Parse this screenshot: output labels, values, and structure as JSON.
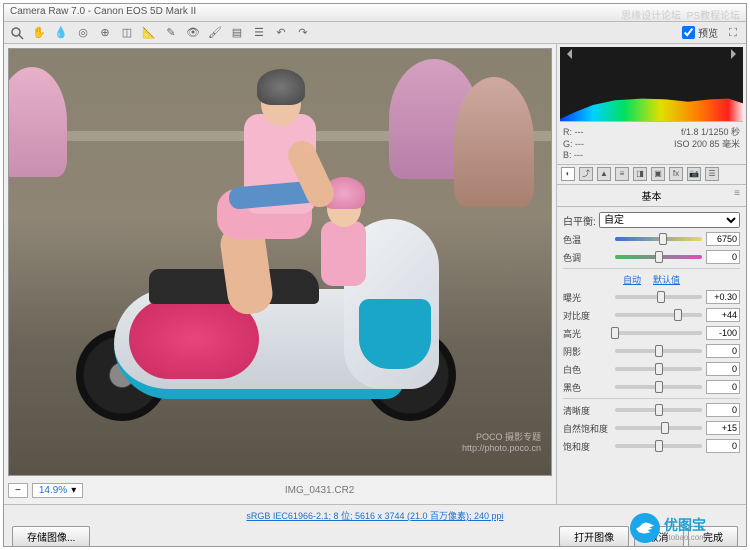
{
  "window": {
    "title": "Camera Raw 7.0  -  Canon EOS 5D Mark II"
  },
  "watermark_top": {
    "left": "思缘设计论坛",
    "right": "PS教程论坛"
  },
  "preview": {
    "label": "预览"
  },
  "zoom": {
    "value": "14.9%"
  },
  "file": {
    "name": "IMG_0431.CR2"
  },
  "exif": {
    "r": "R:",
    "rv": "---",
    "f": "f/1.8  1/1250 秒",
    "g": "G:",
    "gv": "---",
    "iso": "ISO 200   85 毫米",
    "b": "B:",
    "bv": "---"
  },
  "panel": {
    "title": "基本"
  },
  "wb": {
    "label": "白平衡:",
    "value": "自定"
  },
  "links": {
    "auto": "自动",
    "default": "默认值"
  },
  "sliders": {
    "temp": {
      "label": "色温",
      "value": "6750",
      "pos": 55
    },
    "tint": {
      "label": "色调",
      "value": "0",
      "pos": 50
    },
    "exposure": {
      "label": "曝光",
      "value": "+0.30",
      "pos": 53
    },
    "contrast": {
      "label": "对比度",
      "value": "+44",
      "pos": 72
    },
    "highlights": {
      "label": "高光",
      "value": "-100",
      "pos": 0
    },
    "shadows": {
      "label": "阴影",
      "value": "0",
      "pos": 50
    },
    "whites": {
      "label": "白色",
      "value": "0",
      "pos": 50
    },
    "blacks": {
      "label": "黑色",
      "value": "0",
      "pos": 50
    },
    "clarity": {
      "label": "清晰度",
      "value": "0",
      "pos": 50
    },
    "vibrance": {
      "label": "自然饱和度",
      "value": "+15",
      "pos": 58
    },
    "saturation": {
      "label": "饱和度",
      "value": "0",
      "pos": 50
    }
  },
  "bottom": {
    "profile": "sRGB IEC61966-2.1; 8 位; 5616 x 3744 (21.0 百万像素); 240 ppi",
    "save": "存储图像...",
    "open": "打开图像",
    "cancel": "取消",
    "done": "完成"
  },
  "poco": {
    "line1": "POCO 摄影专题",
    "line2": "http://photo.poco.cn"
  },
  "logo": {
    "text": "优图宝",
    "sub": "utobao.com"
  }
}
